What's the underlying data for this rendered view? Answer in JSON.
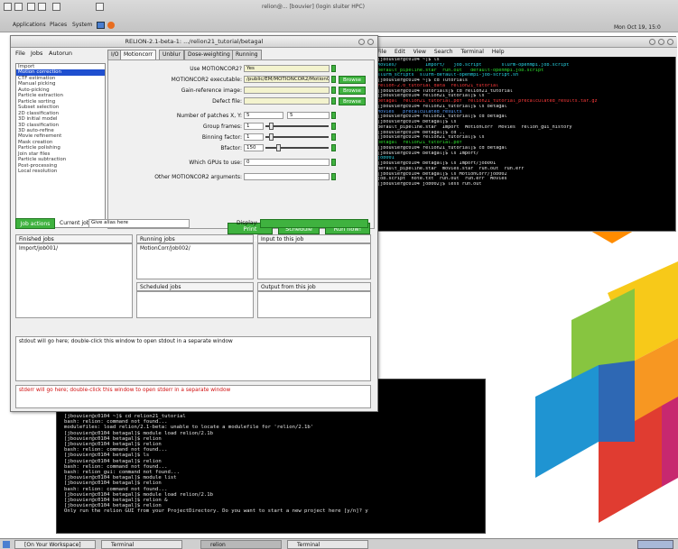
{
  "desktop": {
    "topbar_title": "relion@... [bouvier] (login sluiter HPC)",
    "applications_menu": "Applications",
    "places_menu": "Places",
    "system_menu": "System",
    "clock": "Mon Oct 19, 15:0",
    "colors": {
      "accent_green": "#3fb23f",
      "selection_blue": "#1f4fcf",
      "terminal_bg": "#000000"
    }
  },
  "relion": {
    "window_title": "RELION-2.1-beta-1: .../relion21_tutorial/betagal",
    "menu": [
      "File",
      "Jobs",
      "Autorun"
    ],
    "job_types": [
      "Import",
      "Motion correction",
      "CTF estimation",
      "Manual picking",
      "Auto-picking",
      "Particle extraction",
      "Particle sorting",
      "Subset selection",
      "2D classification",
      "3D initial model",
      "3D classification",
      "3D auto-refine",
      "Movie refinement",
      "Mask creation",
      "Particle polishing",
      "Join star files",
      "Particle subtraction",
      "Post-processing",
      "Local resolution"
    ],
    "selected_job": "Motion correction",
    "tabs": [
      "I/O",
      "Motioncorr",
      "Unblur",
      "Dose-weighting",
      "Running"
    ],
    "active_tab": "Motioncorr",
    "fields": {
      "use_motioncor2_label": "Use MOTIONCOR2?",
      "use_motioncor2_value": "Yes",
      "exe_label": "MOTIONCOR2 executable:",
      "exe_value": "/public/EM/MOTIONCOR2/MotionCor2_1.0.4",
      "gain_label": "Gain-reference image:",
      "gain_value": "",
      "defect_label": "Defect file:",
      "defect_value": "",
      "patches_label": "Number of patches X, Y:",
      "patches_x": "5",
      "patches_y": "5",
      "group_label": "Group frames:",
      "group_value": "1",
      "binning_label": "Binning factor:",
      "binning_value": "1",
      "bfactor_label": "Bfactor:",
      "bfactor_value": "150",
      "gpu_label": "Which GPUs to use:",
      "gpu_value": "0",
      "other_label": "Other MOTIONCOR2 arguments:",
      "other_value": ""
    },
    "browse_label": "Browse",
    "actions": {
      "print_command": "Print command",
      "schedule": "Schedule",
      "run": "Run now!"
    },
    "job_actions_btn": "Job actions",
    "current_job_label": "Current job:",
    "current_job_value": "Give alias here",
    "display_label": "Display:",
    "display_value": "",
    "panels": {
      "finished": "Finished jobs",
      "running": "Running jobs",
      "scheduled": "Scheduled jobs",
      "input": "Input to this job",
      "output": "Output from this job"
    },
    "finished_items": [
      "Import/job001/"
    ],
    "running_items": [
      "MotionCorr/job002/"
    ],
    "stdout_hint": "stdout will go here; double-click this window to open stdout in a separate window",
    "stderr_hint": "stderr will go here; double-click this window to open stderr in a separate window"
  },
  "terminal_right": {
    "menu": [
      "File",
      "Edit",
      "View",
      "Search",
      "Terminal",
      "Help"
    ],
    "lines": [
      {
        "t": "[jbouvier@c0104 ~]$ ls",
        "c": "w"
      },
      {
        "t": "Movies/          Import/   job.script       slurm-openmpi.job.script",
        "c": "c"
      },
      {
        "t": "default_pipeline.star  run.out   default-openmpi.job.script",
        "c": "g"
      },
      {
        "t": "slurm_scripts  slurm-default-openmpi-job-script.sh",
        "c": "c"
      },
      {
        "t": "[jbouvier@c0104 ~]$ cd Tutorials",
        "c": "w"
      },
      {
        "t": "relion-2.0_tutorial_data  relion21_tutorial",
        "c": "r"
      },
      {
        "t": "[jbouvier@c0104 Tutorials]$ cd relion21_tutorial",
        "c": "w"
      },
      {
        "t": "[jbouvier@c0104 relion21_tutorial]$ ls",
        "c": "w"
      },
      {
        "t": "betagal  relion21_tutorial.pdf  relion21_tutorial_precalculated_results.tar.gz",
        "c": "r"
      },
      {
        "t": "[jbouvier@c0104 relion21_tutorial]$ ls betagal",
        "c": "w"
      },
      {
        "t": "Movies   precalculated_results",
        "c": "b"
      },
      {
        "t": "[jbouvier@c0104 relion21_tutorial]$ cd betagal",
        "c": "w"
      },
      {
        "t": "[jbouvier@c0104 betagal]$ ls",
        "c": "w"
      },
      {
        "t": "default_pipeline.star  Import  MotionCorr  Movies  relion_gui_history",
        "c": "w"
      },
      {
        "t": "[jbouvier@c0104 betagal]$ cd ..",
        "c": "w"
      },
      {
        "t": "[jbouvier@c0104 relion21_tutorial]$ ls",
        "c": "w"
      },
      {
        "t": "betagal  relion21_tutorial.pdf",
        "c": "g"
      },
      {
        "t": "[jbouvier@c0104 relion21_tutorial]$ cd betagal",
        "c": "w"
      },
      {
        "t": "[jbouvier@c0104 betagal]$ ls Import/",
        "c": "w"
      },
      {
        "t": "job001",
        "c": "c"
      },
      {
        "t": "[jbouvier@c0104 betagal]$ ls Import/job001",
        "c": "w"
      },
      {
        "t": "default_pipeline.star  movies.star  run.out  run.err",
        "c": "w"
      },
      {
        "t": "[jbouvier@c0104 betagal]$ ls MotionCorr/job002",
        "c": "w"
      },
      {
        "t": "job.script  note.txt  run.out  run.err  Movies",
        "c": "w"
      },
      {
        "t": "[jbouvier@c0104 job002]$ less run.out",
        "c": "w"
      }
    ]
  },
  "terminal_bottom": {
    "lines": [
      "[jbouvier@c0104 ~]$ cd relion21_tutorial",
      "bash: relion: command not found...",
      "modulefiles: load relion/2.1-beta: unable to locate a modulefile for 'relion/2.1b'",
      "[jbouvier@c0104 betagal]$ module load relion/2.1b",
      "[jbouvier@c0104 betagal]$ relion",
      "[jbouvier@c0104 betagal]$ relion",
      "bash: relion: command not found...",
      "[jbouvier@c0104 betagal]$ ls",
      "[jbouvier@c0104 betagal]$ relion",
      "bash: relion: command not found...",
      "bash: relion_gui: command not found...",
      "[jbouvier@c0104 betagal]$ module list",
      "[jbouvier@c0104 betagal]$ relion",
      "bash: relion: command not found...",
      "[jbouvier@c0104 betagal]$ module load relion/2.1b",
      "[jbouvier@c0104 betagal]$ relion &",
      "[jbouvier@c0104 betagal]$ relion",
      "Only run the relion GUI from your ProjectDirectory. Do you want to start a new project here [y/n]? y"
    ]
  },
  "taskbar": {
    "items": [
      "[On Your Workspace]",
      "Terminal",
      "relion",
      "Terminal"
    ]
  }
}
